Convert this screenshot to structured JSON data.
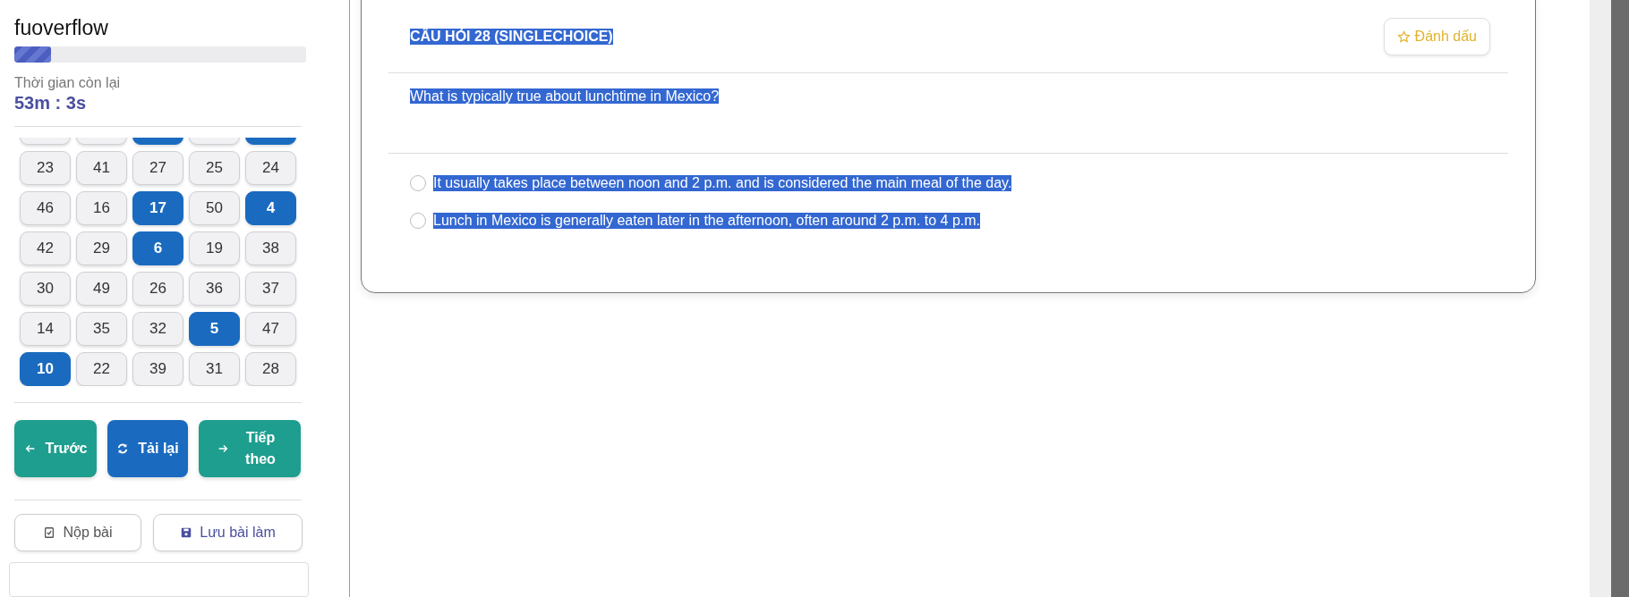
{
  "sidebar": {
    "title": "fuoverflow",
    "progress": {
      "level": 0.125
    },
    "time_label": "Thời gian còn lại",
    "time_value": "53m : 3s",
    "partial_row": [
      {
        "selected": false
      },
      {
        "selected": false
      },
      {
        "selected": true
      },
      {
        "selected": false
      },
      {
        "selected": true
      }
    ],
    "questions": [
      {
        "label": "23",
        "selected": false
      },
      {
        "label": "41",
        "selected": false
      },
      {
        "label": "27",
        "selected": false
      },
      {
        "label": "25",
        "selected": false
      },
      {
        "label": "24",
        "selected": false
      },
      {
        "label": "46",
        "selected": false
      },
      {
        "label": "16",
        "selected": false
      },
      {
        "label": "17",
        "selected": true
      },
      {
        "label": "50",
        "selected": false
      },
      {
        "label": "4",
        "selected": true
      },
      {
        "label": "42",
        "selected": false
      },
      {
        "label": "29",
        "selected": false
      },
      {
        "label": "6",
        "selected": true
      },
      {
        "label": "19",
        "selected": false
      },
      {
        "label": "38",
        "selected": false
      },
      {
        "label": "30",
        "selected": false
      },
      {
        "label": "49",
        "selected": false
      },
      {
        "label": "26",
        "selected": false
      },
      {
        "label": "36",
        "selected": false
      },
      {
        "label": "37",
        "selected": false
      },
      {
        "label": "14",
        "selected": false
      },
      {
        "label": "35",
        "selected": false
      },
      {
        "label": "32",
        "selected": false
      },
      {
        "label": "5",
        "selected": true
      },
      {
        "label": "47",
        "selected": false
      },
      {
        "label": "10",
        "selected": true
      },
      {
        "label": "22",
        "selected": false
      },
      {
        "label": "39",
        "selected": false
      },
      {
        "label": "31",
        "selected": false
      },
      {
        "label": "28",
        "selected": false
      }
    ],
    "nav_buttons": [
      {
        "kind": "prev",
        "label": "Trước"
      },
      {
        "kind": "reload",
        "label": "Tải lại"
      },
      {
        "kind": "next",
        "label": "Tiếp theo"
      }
    ],
    "action_buttons": [
      {
        "kind": "submit",
        "label": "Nộp bài"
      },
      {
        "kind": "save",
        "label": "Lưu bài làm"
      }
    ]
  },
  "question": {
    "heading": "CÂU HỎI 28 (SINGLECHOICE)",
    "mark_button": "Đánh dấu",
    "text": "What is typically true about lunchtime in Mexico?",
    "options": [
      {
        "text": "It usually takes place between noon and 2 p.m. and is considered the main meal of the day.",
        "selected": false
      },
      {
        "text": "Lunch in Mexico is generally eaten later in the afternoon, often around 2 p.m. to 4 p.m.",
        "selected": false
      }
    ]
  }
}
